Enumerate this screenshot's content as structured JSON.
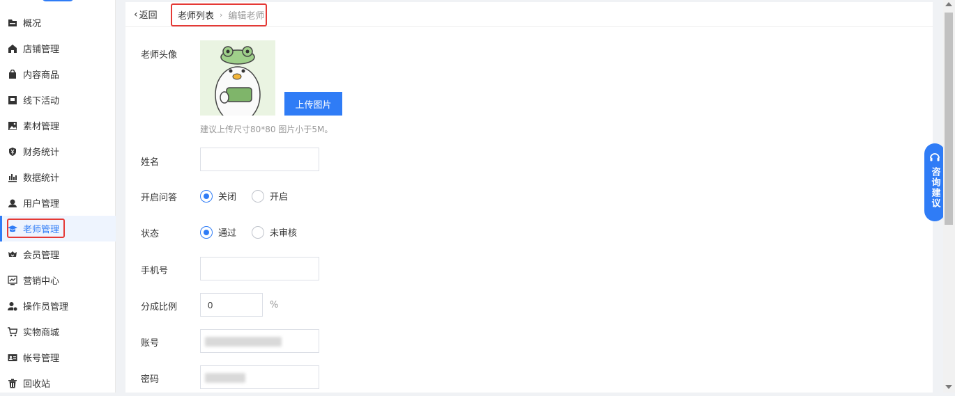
{
  "sidebar": {
    "items": [
      {
        "label": "概况",
        "icon": "folder-icon"
      },
      {
        "label": "店铺管理",
        "icon": "store-icon"
      },
      {
        "label": "内容商品",
        "icon": "bag-icon"
      },
      {
        "label": "线下活动",
        "icon": "flag-icon"
      },
      {
        "label": "素材管理",
        "icon": "image-icon"
      },
      {
        "label": "财务统计",
        "icon": "yen-shield-icon"
      },
      {
        "label": "数据统计",
        "icon": "bar-chart-icon"
      },
      {
        "label": "用户管理",
        "icon": "user-icon"
      },
      {
        "label": "老师管理",
        "icon": "graduation-cap-icon",
        "active": true
      },
      {
        "label": "会员管理",
        "icon": "vip-badge-icon"
      },
      {
        "label": "营销中心",
        "icon": "trend-icon"
      },
      {
        "label": "操作员管理",
        "icon": "user-gear-icon"
      },
      {
        "label": "实物商城",
        "icon": "cart-icon"
      },
      {
        "label": "帐号管理",
        "icon": "id-card-icon"
      },
      {
        "label": "回收站",
        "icon": "trash-icon"
      }
    ]
  },
  "header": {
    "back_label": "返回",
    "breadcrumb": [
      "老师列表",
      "编辑老师"
    ]
  },
  "form": {
    "avatar_label": "老师头像",
    "upload_label": "上传图片",
    "upload_hint": "建议上传尺寸80*80 图片小于5M。",
    "name_label": "姓名",
    "name_value": "",
    "qa_label": "开启问答",
    "qa_options": [
      "关闭",
      "开启"
    ],
    "qa_selected": "关闭",
    "status_label": "状态",
    "status_options": [
      "通过",
      "未审核"
    ],
    "status_selected": "通过",
    "phone_label": "手机号",
    "phone_value": "",
    "ratio_label": "分成比例",
    "ratio_value": "0",
    "ratio_suffix": "%",
    "account_label": "账号",
    "password_label": "密码"
  },
  "consult": {
    "label": "咨询建议"
  },
  "colors": {
    "primary": "#2f7cf6",
    "highlight": "#e53935"
  }
}
